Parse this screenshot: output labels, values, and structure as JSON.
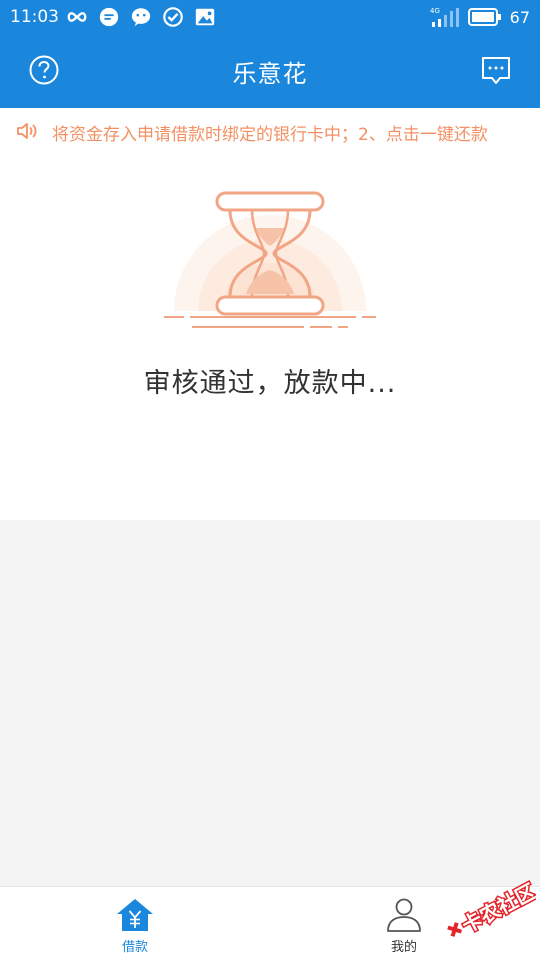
{
  "status_bar": {
    "time": "11:03",
    "network": "4G",
    "battery": "67"
  },
  "header": {
    "title": "乐意花"
  },
  "notice": {
    "text": "将资金存入申请借款时绑定的银行卡中；2、点击一键还款"
  },
  "status": {
    "message": "审核通过，放款中..."
  },
  "tabs": [
    {
      "label": "借款",
      "icon": "home-yuan-icon",
      "active": true
    },
    {
      "label": "我的",
      "icon": "person-icon",
      "active": false
    }
  ],
  "watermark": {
    "text": "卡农社区"
  },
  "colors": {
    "primary": "#1a87dc",
    "accent": "#f39164",
    "text": "#333333",
    "background": "#f4f4f4"
  }
}
